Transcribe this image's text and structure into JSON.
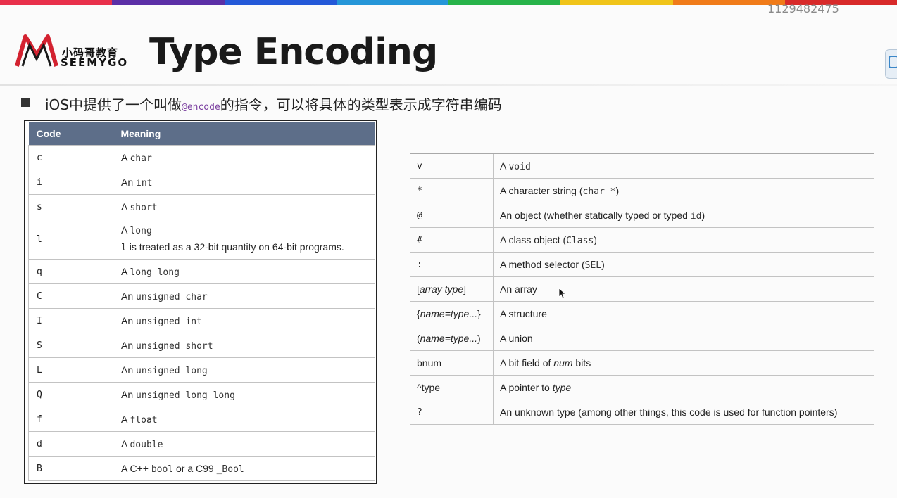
{
  "watermark": "1129482475",
  "logo": {
    "cn": "小码哥教育",
    "en": "SEEMYGO"
  },
  "title": "Type Encoding",
  "bullet": {
    "prefix": "iOS中提供了一个叫做",
    "directive": "@encode",
    "suffix": "的指令，可以将具体的类型表示成字符串编码"
  },
  "colors": {
    "header_bg": "#5d6e89",
    "border": "#c3c3c3",
    "accent_purple": "#7b3fa0"
  },
  "left_table": {
    "headers": [
      "Code",
      "Meaning"
    ],
    "rows": [
      {
        "code": "c",
        "pre": "A",
        "mono": "char"
      },
      {
        "code": "i",
        "pre": "An",
        "mono": "int"
      },
      {
        "code": "s",
        "pre": "A",
        "mono": "short"
      },
      {
        "code": "l",
        "pre": "A",
        "mono": "long",
        "note_code": "l",
        "note_text": "is treated as a 32-bit quantity on 64-bit programs."
      },
      {
        "code": "q",
        "pre": "A",
        "mono": "long long"
      },
      {
        "code": "C",
        "pre": "An",
        "mono": "unsigned char"
      },
      {
        "code": "I",
        "pre": "An",
        "mono": "unsigned int"
      },
      {
        "code": "S",
        "pre": "An",
        "mono": "unsigned short"
      },
      {
        "code": "L",
        "pre": "An",
        "mono": "unsigned long"
      },
      {
        "code": "Q",
        "pre": "An",
        "mono": "unsigned long long"
      },
      {
        "code": "f",
        "pre": "A",
        "mono": "float"
      },
      {
        "code": "d",
        "pre": "A",
        "mono": "double"
      },
      {
        "code": "B",
        "pre": "A C++",
        "mono": "bool",
        "mid": "or a C99",
        "mono2": "_Bool"
      }
    ]
  },
  "right_table": {
    "rows": [
      {
        "code": "v",
        "pre": "A",
        "mono": "void"
      },
      {
        "code": "*",
        "pre": "A character string (",
        "mono": "char *",
        "post": ")"
      },
      {
        "code": "@",
        "pre": "An object (whether statically typed or typed",
        "mono": "id",
        "post": ")"
      },
      {
        "code": "#",
        "pre": "A class object (",
        "mono": "Class",
        "post": ")"
      },
      {
        "code": ":",
        "pre": "A method selector (",
        "mono": "SEL",
        "post": ")"
      },
      {
        "code_open": "[",
        "code_ital": "array type",
        "code_close": "]",
        "pre": "An array"
      },
      {
        "code_open": "{",
        "code_ital": "name=type...",
        "code_close": "}",
        "pre": "A structure"
      },
      {
        "code_open": "(",
        "code_ital": "name=type...",
        "code_close": ")",
        "pre": "A union"
      },
      {
        "code_plain": "bnum",
        "pre": "A bit field of",
        "ital": "num",
        "post": "bits"
      },
      {
        "code_plain": "^type",
        "pre": "A pointer to",
        "ital": "type"
      },
      {
        "code": "?",
        "pre": "An unknown type (among other things, this code is used for function pointers)"
      }
    ]
  }
}
